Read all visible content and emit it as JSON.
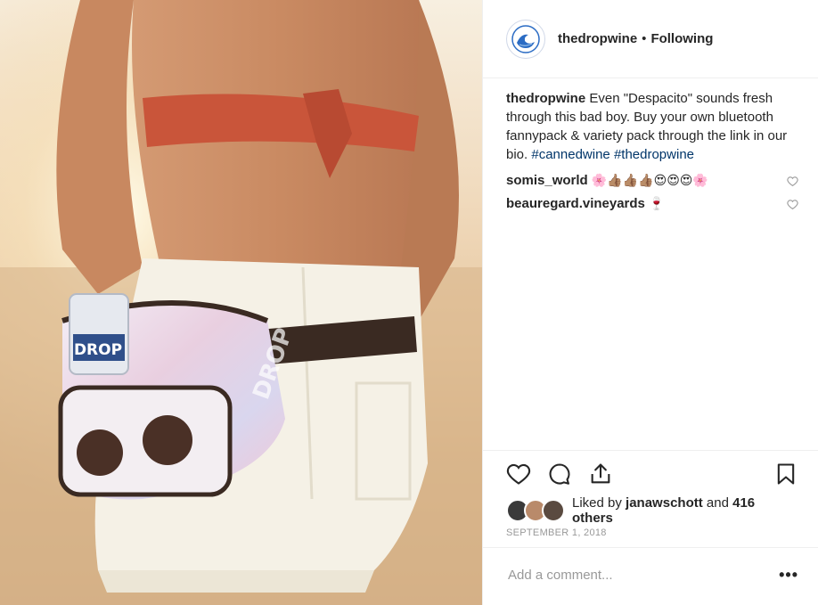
{
  "header": {
    "username": "thedropwine",
    "separator": "•",
    "follow_status": "Following",
    "avatar_icon": "wave-logo-icon"
  },
  "caption": {
    "username": "thedropwine",
    "text": "Even \"Despacito\" sounds fresh through this bad boy. Buy your own bluetooth fannypack & variety pack through the link in our bio.",
    "hashtags": [
      "#cannedwine",
      "#thedropwine"
    ]
  },
  "comments": [
    {
      "username": "somis_world",
      "text": "🌸👍🏽👍🏽👍🏽😍😍😍🌸"
    },
    {
      "username": "beauregard.vineyards",
      "text": "🍷"
    }
  ],
  "likes": {
    "prefix": "Liked by",
    "user": "janawschott",
    "joiner": "and",
    "others": "416 others"
  },
  "date": "SEPTEMBER 1, 2018",
  "add_comment": {
    "placeholder": "Add a comment..."
  },
  "more_label": "•••",
  "icons": {
    "like": "heart-icon",
    "comment": "comment-icon",
    "share": "share-icon",
    "save": "bookmark-icon"
  },
  "photo": {
    "can_label": "DROP",
    "pack_label": "DROP"
  }
}
